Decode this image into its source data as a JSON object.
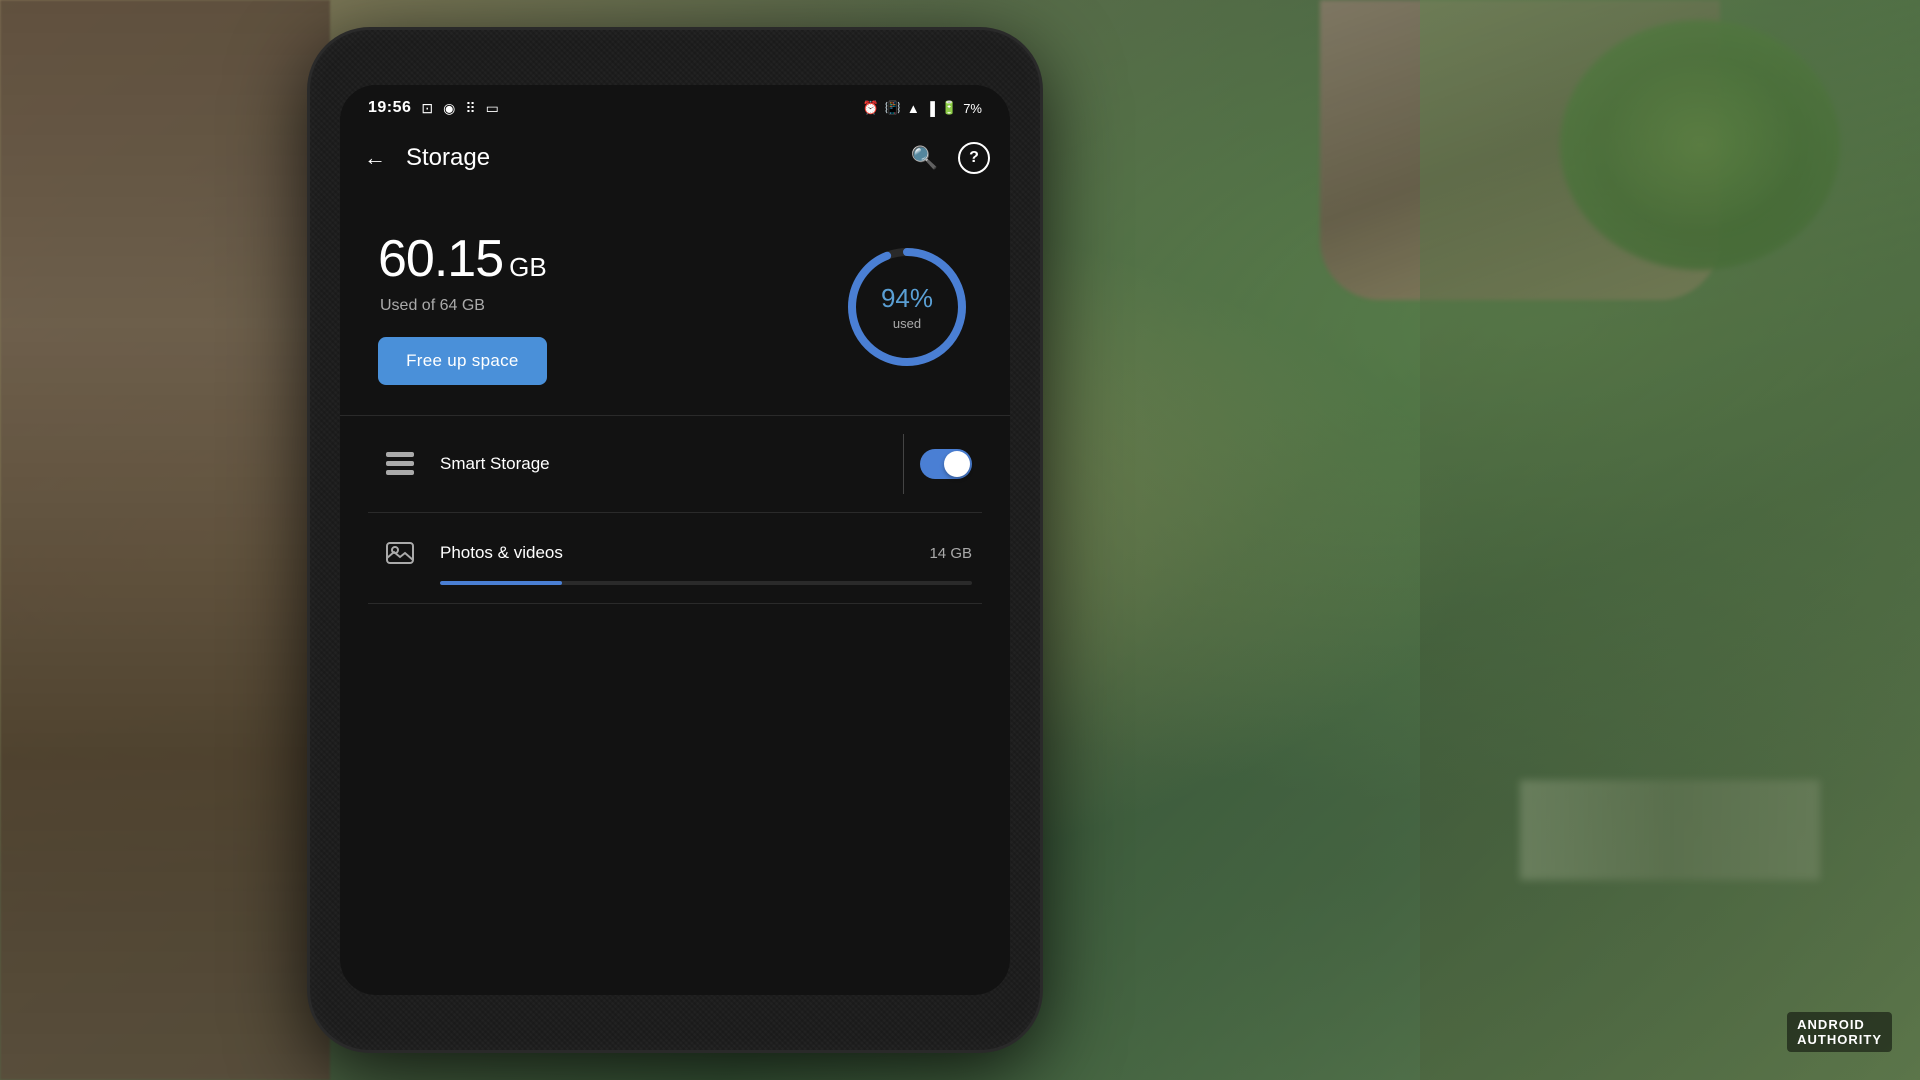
{
  "background": {
    "colors": [
      "#5a6a4a",
      "#3a5a3a",
      "#8a7a5a"
    ]
  },
  "status_bar": {
    "time": "19:56",
    "icons_left": [
      "cast",
      "location",
      "audio-wave",
      "screen"
    ],
    "icons_right": [
      "alarm",
      "vibrate",
      "wifi",
      "signal",
      "battery"
    ],
    "battery_percent": "7%"
  },
  "app_bar": {
    "back_label": "←",
    "title": "Storage",
    "search_icon": "🔍",
    "help_icon": "?"
  },
  "storage": {
    "used_amount": "60.15",
    "used_unit": "GB",
    "used_of_label": "Used of 64 GB",
    "free_up_button": "Free up space",
    "circle_percent": "94%",
    "circle_label": "used",
    "circle_fill_percent": 94
  },
  "list_items": [
    {
      "icon": "smart-storage",
      "title": "Smart Storage",
      "subtitle": "",
      "size": "",
      "has_toggle": true,
      "toggle_on": true,
      "has_progress": false
    },
    {
      "icon": "photos",
      "title": "Photos & videos",
      "subtitle": "",
      "size": "14 GB",
      "has_toggle": false,
      "toggle_on": false,
      "has_progress": true,
      "progress_percent": 23
    }
  ],
  "watermark": {
    "line1": "ANDROID",
    "line2": "AUTHORITY"
  }
}
